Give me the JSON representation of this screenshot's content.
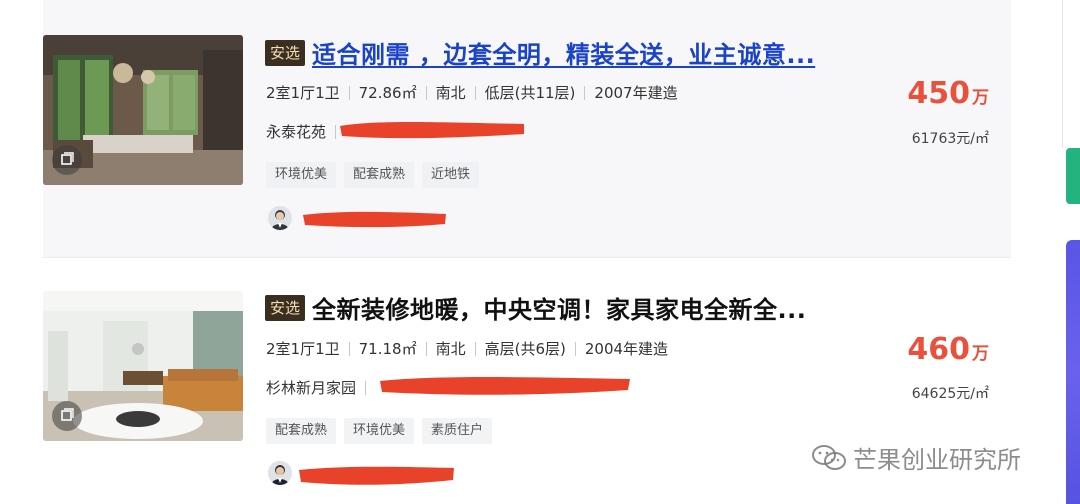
{
  "listings": [
    {
      "badge": "安选",
      "title": "适合刚需 ，边套全明，精装全送，业主诚意...",
      "specs": [
        "2室1厅1卫",
        "72.86㎡",
        "南北",
        "低层(共11层)",
        "2007年建造"
      ],
      "community": "永泰花苑",
      "tags": [
        "环境优美",
        "配套成熟",
        "近地铁"
      ],
      "price": "450",
      "price_unit": "万",
      "unit_price": "61763元/㎡"
    },
    {
      "badge": "安选",
      "title": "全新装修地暖，中央空调！家具家电全新全...",
      "specs": [
        "2室1厅1卫",
        "71.18㎡",
        "南北",
        "高层(共6层)",
        "2004年建造"
      ],
      "community": "杉林新月家园",
      "tags": [
        "配套成熟",
        "环境优美",
        "素质住户"
      ],
      "price": "460",
      "price_unit": "万",
      "unit_price": "64625元/㎡"
    }
  ],
  "watermark": "芒果创业研究所",
  "colors": {
    "price": "#e8513c",
    "title_link": "#1a43c8",
    "badge_bg": "#3a2e20",
    "badge_text": "#f5dfb4",
    "redaction": "#e8432a",
    "side_green": "#22b37e",
    "side_blue": "#5a55e6"
  },
  "icons": [
    "vr-view-icon",
    "agent-avatar",
    "wechat-icon"
  ]
}
